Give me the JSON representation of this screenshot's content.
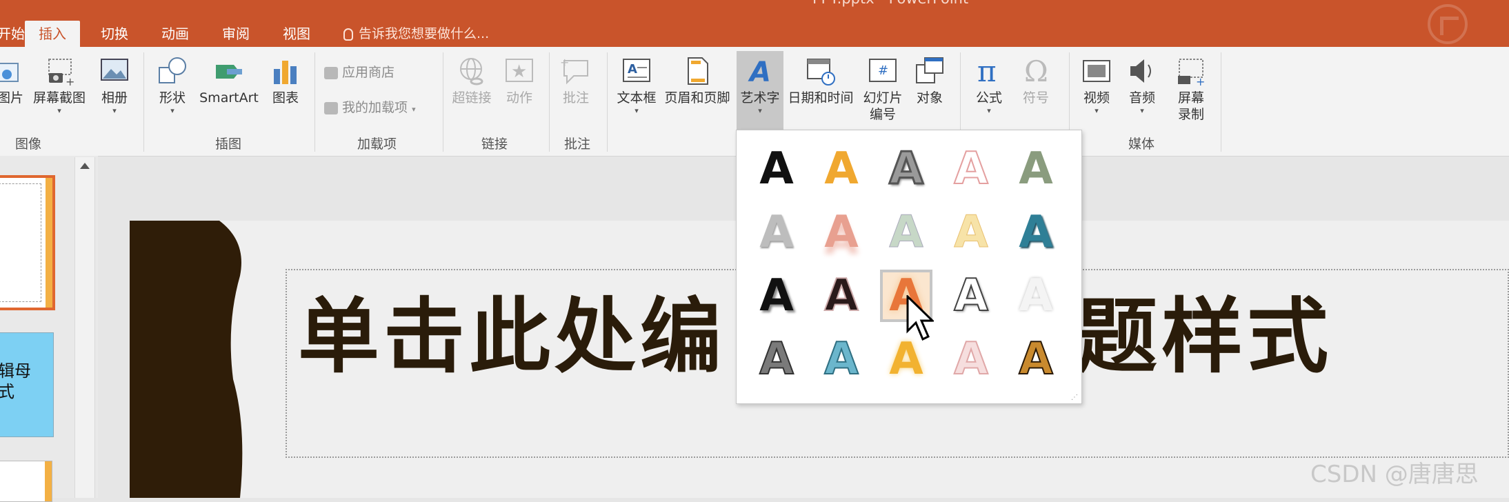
{
  "window": {
    "title": "PPT.pptx - PowerPoint"
  },
  "tabs": [
    {
      "label": "开始"
    },
    {
      "label": "插入"
    },
    {
      "label": "切换"
    },
    {
      "label": "动画"
    },
    {
      "label": "审阅"
    },
    {
      "label": "视图"
    }
  ],
  "tell_me": {
    "text": "告诉我您想要做什么..."
  },
  "ribbon": {
    "images": {
      "pictures": "图片",
      "screenshot": "屏幕截图",
      "album": "相册",
      "group": "图像"
    },
    "illustrations": {
      "shapes": "形状",
      "smartart": "SmartArt",
      "chart": "图表",
      "group": "插图"
    },
    "addins": {
      "store": "应用商店",
      "my_addins": "我的加载项",
      "group": "加载项"
    },
    "links": {
      "hyperlink": "超链接",
      "action": "动作",
      "group": "链接"
    },
    "comments": {
      "comment": "批注",
      "group": "批注"
    },
    "text": {
      "textbox": "文本框",
      "header_footer": "页眉和页脚",
      "wordart": "艺术字",
      "datetime": "日期和时间",
      "slide_number_1": "幻灯片",
      "slide_number_2": "编号",
      "object": "对象"
    },
    "symbols": {
      "equation": "公式",
      "symbol": "符号"
    },
    "media": {
      "video": "视频",
      "audio": "音频",
      "screen_rec_1": "屏幕",
      "screen_rec_2": "录制",
      "group": "媒体"
    }
  },
  "thumbnail": {
    "text": "辑母\n式"
  },
  "slide": {
    "title_left": "单击此处编",
    "title_right": "题样式"
  },
  "wordart_gallery": {
    "glyph": "A",
    "styles": [
      [
        "plain-black",
        "orange-gradient",
        "gray-outline-shadow",
        "pink-outline",
        "olive-gradient"
      ],
      [
        "light-gray",
        "red-reflection",
        "pale-green",
        "pale-yellow-outline",
        "teal-bevel"
      ],
      [
        "black-shadow",
        "dark-outline",
        "orange-glow",
        "white-outline-shadow",
        "white-soft"
      ],
      [
        "gray-pattern",
        "blue-pattern",
        "gold-bevel",
        "pink-pattern",
        "gold-stripes"
      ]
    ]
  },
  "watermark": {
    "text": "CSDN @唐唐思"
  },
  "colors": {
    "accent": "#c9542b",
    "slide_title": "#2a1c0a",
    "slide_dark": "#2f1d08"
  }
}
